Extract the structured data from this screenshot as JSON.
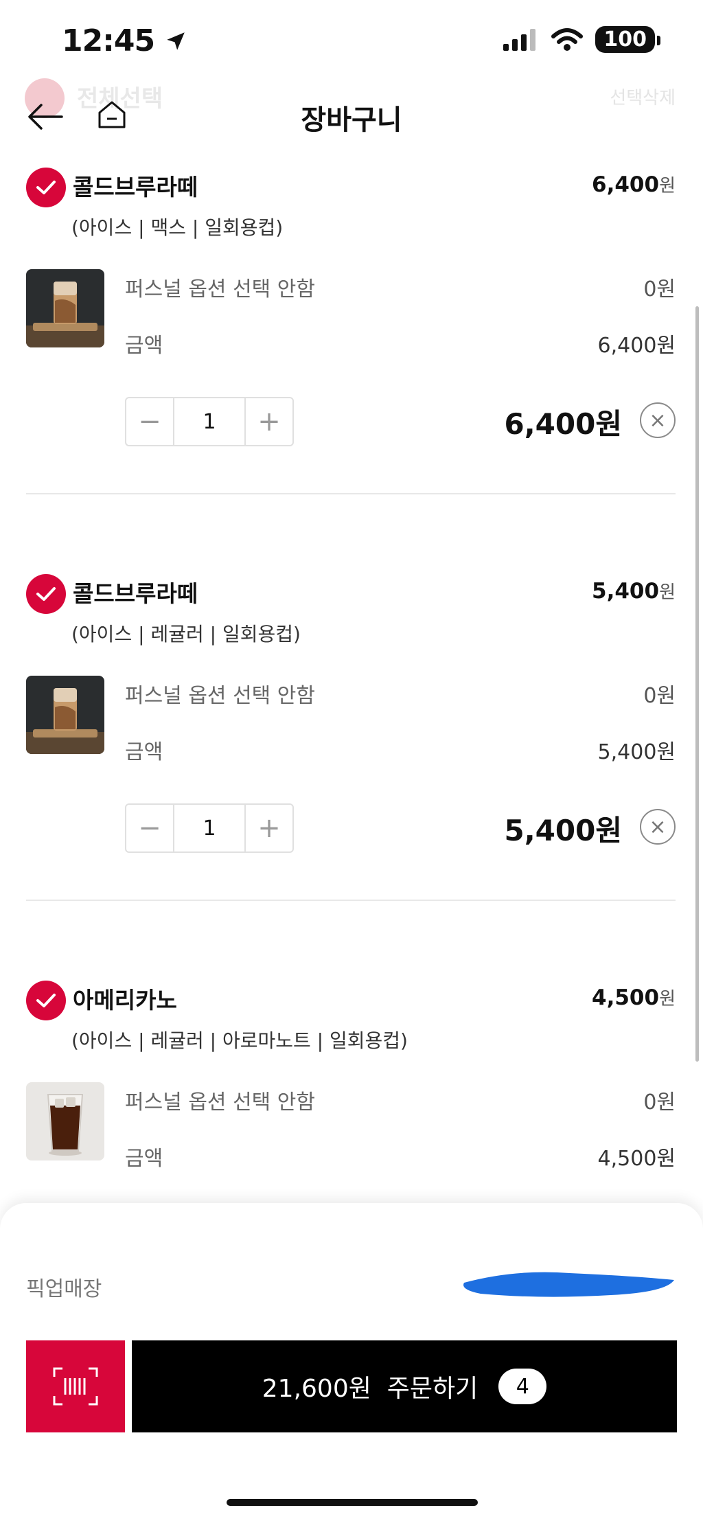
{
  "status_bar": {
    "time": "12:45",
    "battery": "100"
  },
  "header": {
    "title": "장바구니",
    "select_all_label": "전체선택",
    "delete_selected_label": "선택삭제"
  },
  "colors": {
    "accent": "#d7063a",
    "order_button": "#000000",
    "redaction": "#1e6fe0"
  },
  "items": [
    {
      "name": "콜드브루라떼",
      "unit_price": "6,400",
      "currency": "원",
      "options": "(아이스 | 맥스 | 일회용컵)",
      "personal_option_label": "퍼스널 옵션 선택 안함",
      "personal_option_price": "0원",
      "amount_label": "금액",
      "amount": "6,400원",
      "quantity": "1",
      "total": "6,400원",
      "thumbnail": "cold-brew-latte"
    },
    {
      "name": "콜드브루라떼",
      "unit_price": "5,400",
      "currency": "원",
      "options": "(아이스 | 레귤러 | 일회용컵)",
      "personal_option_label": "퍼스널 옵션 선택 안함",
      "personal_option_price": "0원",
      "amount_label": "금액",
      "amount": "5,400원",
      "quantity": "1",
      "total": "5,400원",
      "thumbnail": "cold-brew-latte"
    },
    {
      "name": "아메리카노",
      "unit_price": "4,500",
      "currency": "원",
      "options": "(아이스 | 레귤러 | 아로마노트 | 일회용컵)",
      "personal_option_label": "퍼스널 옵션 선택 안함",
      "personal_option_price": "0원",
      "amount_label": "금액",
      "amount": "4,500원",
      "thumbnail": "iced-americano"
    }
  ],
  "bottom": {
    "pickup_label": "픽업매장",
    "order_total": "21,600원",
    "order_label": "주문하기",
    "order_count": "4"
  }
}
